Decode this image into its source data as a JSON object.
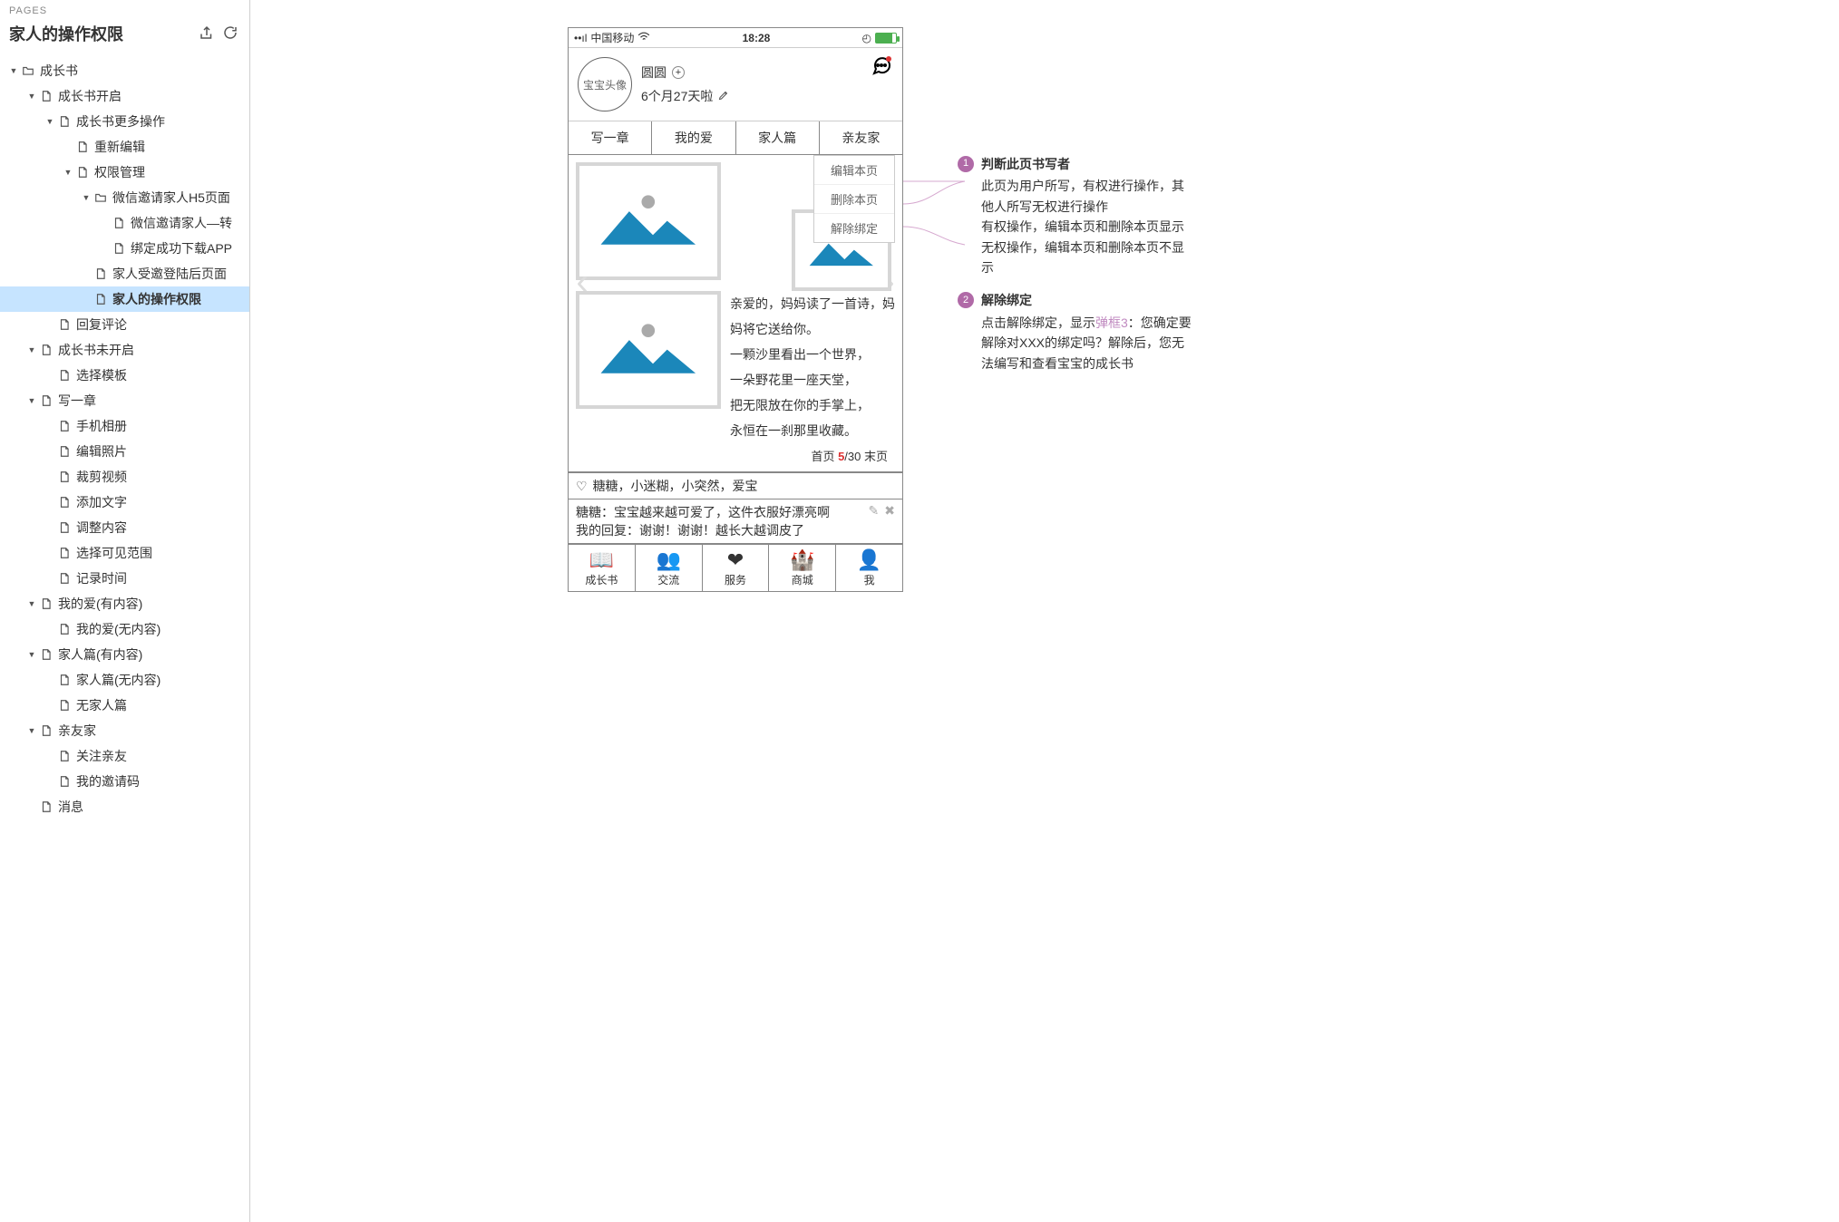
{
  "sidebar": {
    "pages_label": "PAGES",
    "title": "家人的操作权限",
    "tree": [
      {
        "depth": 0,
        "type": "folder",
        "expandable": true,
        "label": "成长书"
      },
      {
        "depth": 1,
        "type": "page",
        "expandable": true,
        "label": "成长书开启"
      },
      {
        "depth": 2,
        "type": "page",
        "expandable": true,
        "label": "成长书更多操作"
      },
      {
        "depth": 3,
        "type": "page",
        "expandable": false,
        "label": "重新编辑"
      },
      {
        "depth": 3,
        "type": "page",
        "expandable": true,
        "label": "权限管理"
      },
      {
        "depth": 4,
        "type": "folder",
        "expandable": true,
        "label": "微信邀请家人H5页面"
      },
      {
        "depth": 5,
        "type": "page",
        "expandable": false,
        "label": "微信邀请家人—转"
      },
      {
        "depth": 5,
        "type": "page",
        "expandable": false,
        "label": "绑定成功下载APP"
      },
      {
        "depth": 4,
        "type": "page",
        "expandable": false,
        "label": "家人受邀登陆后页面"
      },
      {
        "depth": 4,
        "type": "page",
        "expandable": false,
        "label": "家人的操作权限",
        "selected": true
      },
      {
        "depth": 2,
        "type": "page",
        "expandable": false,
        "label": "回复评论"
      },
      {
        "depth": 1,
        "type": "page",
        "expandable": true,
        "label": "成长书未开启"
      },
      {
        "depth": 2,
        "type": "page",
        "expandable": false,
        "label": "选择模板"
      },
      {
        "depth": 1,
        "type": "page",
        "expandable": true,
        "label": "写一章"
      },
      {
        "depth": 2,
        "type": "page",
        "expandable": false,
        "label": "手机相册"
      },
      {
        "depth": 2,
        "type": "page",
        "expandable": false,
        "label": "编辑照片"
      },
      {
        "depth": 2,
        "type": "page",
        "expandable": false,
        "label": "裁剪视频"
      },
      {
        "depth": 2,
        "type": "page",
        "expandable": false,
        "label": "添加文字"
      },
      {
        "depth": 2,
        "type": "page",
        "expandable": false,
        "label": "调整内容"
      },
      {
        "depth": 2,
        "type": "page",
        "expandable": false,
        "label": "选择可见范围"
      },
      {
        "depth": 2,
        "type": "page",
        "expandable": false,
        "label": "记录时间"
      },
      {
        "depth": 1,
        "type": "page",
        "expandable": true,
        "label": "我的爱(有内容)"
      },
      {
        "depth": 2,
        "type": "page",
        "expandable": false,
        "label": "我的爱(无内容)"
      },
      {
        "depth": 1,
        "type": "page",
        "expandable": true,
        "label": "家人篇(有内容)"
      },
      {
        "depth": 2,
        "type": "page",
        "expandable": false,
        "label": "家人篇(无内容)"
      },
      {
        "depth": 2,
        "type": "page",
        "expandable": false,
        "label": "无家人篇"
      },
      {
        "depth": 1,
        "type": "page",
        "expandable": true,
        "label": "亲友家"
      },
      {
        "depth": 2,
        "type": "page",
        "expandable": false,
        "label": "关注亲友"
      },
      {
        "depth": 2,
        "type": "page",
        "expandable": false,
        "label": "我的邀请码"
      },
      {
        "depth": 1,
        "type": "page",
        "expandable": false,
        "label": "消息"
      }
    ]
  },
  "phone": {
    "carrier": "中国移动",
    "time": "18:28",
    "avatar_text": "宝宝头像",
    "name": "圆圆",
    "age": "6个月27天啦",
    "tabs": [
      "写一章",
      "我的爱",
      "家人篇",
      "亲友家"
    ],
    "dropdown": [
      "编辑本页",
      "删除本页",
      "解除绑定"
    ],
    "poem": [
      "亲爱的，妈妈读了一首诗，妈妈将它送给你。",
      "一颗沙里看出一个世界，",
      "一朵野花里一座天堂，",
      "把无限放在你的手掌上，",
      "永恒在一刹那里收藏。"
    ],
    "pager_prefix": "首页  ",
    "pager_cur": "5",
    "pager_total": "/30",
    "pager_suffix": "  末页",
    "likes": "糖糖，小迷糊，小突然，爱宝",
    "comment": "糖糖：宝宝越来越可爱了，这件衣服好漂亮啊",
    "reply": "我的回复：谢谢！谢谢！越长大越调皮了",
    "bottom_tabs": [
      {
        "icon": "📖",
        "label": "成长书"
      },
      {
        "icon": "👥",
        "label": "交流"
      },
      {
        "icon": "❤",
        "label": "服务"
      },
      {
        "icon": "🏰",
        "label": "商城"
      },
      {
        "icon": "👤",
        "label": "我"
      }
    ]
  },
  "annot": [
    {
      "num": "1",
      "title": "判断此页书写者",
      "body_pre": "此页为用户所写，有权进行操作，其他人所写无权进行操作\n有权操作，编辑本页和删除本页显示\n无权操作，编辑本页和删除本页不显示",
      "link": "",
      "body_post": ""
    },
    {
      "num": "2",
      "title": "解除绑定",
      "body_pre": "点击解除绑定，显示",
      "link": "弹框3",
      "body_post": "：您确定要解除对XXX的绑定吗？解除后，您无法编写和查看宝宝的成长书"
    }
  ]
}
